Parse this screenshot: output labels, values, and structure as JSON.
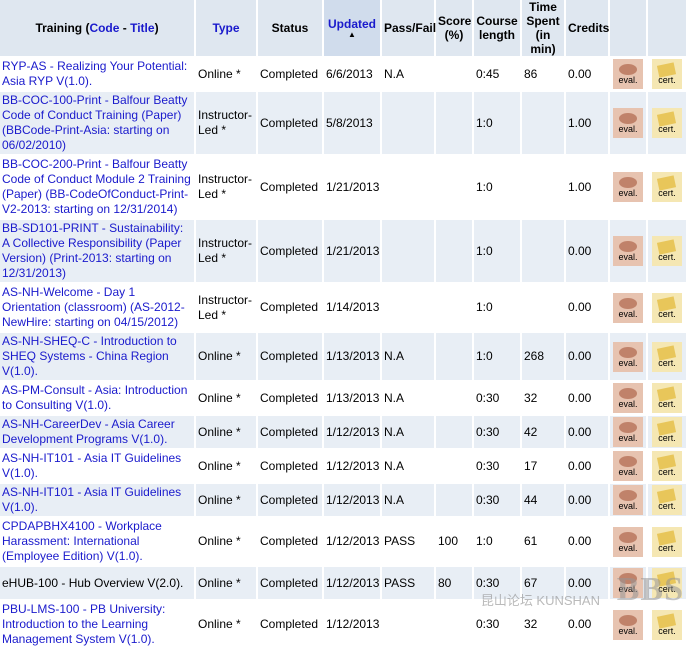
{
  "headers": {
    "training_prefix": "Training (",
    "code_link": "Code",
    "sep": " - ",
    "title_link": "Title",
    "training_suffix": ")",
    "type": "Type",
    "status": "Status",
    "updated": "Updated",
    "pass_fail": "Pass/Fail",
    "score": "Score (%)",
    "course_length": "Course length",
    "time_spent": "Time Spent (in min)",
    "credits": "Credits"
  },
  "eval_label": "eval.",
  "cert_label": "cert.",
  "rows": [
    {
      "training": "RYP-AS - Realizing Your Potential: Asia RYP V(1.0).",
      "type": "Online *",
      "status": "Completed",
      "updated": "6/6/2013",
      "pass": "N.A",
      "score": "",
      "length": "0:45",
      "time": "86",
      "credits": "0.00"
    },
    {
      "training": "BB-COC-100-Print - Balfour Beatty Code of Conduct Training (Paper) (BBCode-Print-Asia: starting on 06/02/2010)",
      "type": "Instructor-Led *",
      "status": "Completed",
      "updated": "5/8/2013",
      "pass": "",
      "score": "",
      "length": "1:0",
      "time": "",
      "credits": "1.00"
    },
    {
      "training": "BB-COC-200-Print - Balfour Beatty Code of Conduct Module 2 Training (Paper) (BB-CodeOfConduct-Print-V2-2013: starting on 12/31/2014)",
      "type": "Instructor-Led *",
      "status": "Completed",
      "updated": "1/21/2013",
      "pass": "",
      "score": "",
      "length": "1:0",
      "time": "",
      "credits": "1.00"
    },
    {
      "training": "BB-SD101-PRINT - Sustainability: A Collective Responsibility (Paper Version) (Print-2013: starting on 12/31/2013)",
      "type": "Instructor-Led *",
      "status": "Completed",
      "updated": "1/21/2013",
      "pass": "",
      "score": "",
      "length": "1:0",
      "time": "",
      "credits": "0.00"
    },
    {
      "training": "AS-NH-Welcome - Day 1 Orientation (classroom) (AS-2012-NewHire: starting on 04/15/2012)",
      "type": "Instructor-Led *",
      "status": "Completed",
      "updated": "1/14/2013",
      "pass": "",
      "score": "",
      "length": "1:0",
      "time": "",
      "credits": "0.00"
    },
    {
      "training": "AS-NH-SHEQ-C - Introduction to SHEQ Systems - China Region V(1.0).",
      "type": "Online *",
      "status": "Completed",
      "updated": "1/13/2013",
      "pass": "N.A",
      "score": "",
      "length": "1:0",
      "time": "268",
      "credits": "0.00"
    },
    {
      "training": "AS-PM-Consult - Asia: Introduction to Consulting V(1.0).",
      "type": "Online *",
      "status": "Completed",
      "updated": "1/13/2013",
      "pass": "N.A",
      "score": "",
      "length": "0:30",
      "time": "32",
      "credits": "0.00"
    },
    {
      "training": "AS-NH-CareerDev - Asia Career Development Programs V(1.0).",
      "type": "Online *",
      "status": "Completed",
      "updated": "1/12/2013",
      "pass": "N.A",
      "score": "",
      "length": "0:30",
      "time": "42",
      "credits": "0.00"
    },
    {
      "training": "AS-NH-IT101 - Asia IT Guidelines V(1.0).",
      "type": "Online *",
      "status": "Completed",
      "updated": "1/12/2013",
      "pass": "N.A",
      "score": "",
      "length": "0:30",
      "time": "17",
      "credits": "0.00"
    },
    {
      "training": "AS-NH-IT101 - Asia IT Guidelines V(1.0).",
      "type": "Online *",
      "status": "Completed",
      "updated": "1/12/2013",
      "pass": "N.A",
      "score": "",
      "length": "0:30",
      "time": "44",
      "credits": "0.00"
    },
    {
      "training": "CPDAPBHX4100 - Workplace Harassment: International (Employee Edition) V(1.0).",
      "type": "Online *",
      "status": "Completed",
      "updated": "1/12/2013",
      "pass": "PASS",
      "score": "100",
      "length": "1:0",
      "time": "61",
      "credits": "0.00"
    },
    {
      "training": "eHUB-100 - Hub Overview V(2.0).",
      "type": "Online *",
      "status": "Completed",
      "updated": "1/12/2013",
      "pass": "PASS",
      "score": "80",
      "length": "0:30",
      "time": "67",
      "credits": "0.00",
      "plain": true
    },
    {
      "training": "PBU-LMS-100 - PB University: Introduction to the Learning Management System V(1.0).",
      "type": "Online *",
      "status": "Completed",
      "updated": "1/12/2013",
      "pass": "",
      "score": "",
      "length": "0:30",
      "time": "32",
      "credits": "0.00"
    }
  ],
  "watermark": {
    "text": "BBS",
    "sub": "昆山论坛 KUNSHAN"
  }
}
